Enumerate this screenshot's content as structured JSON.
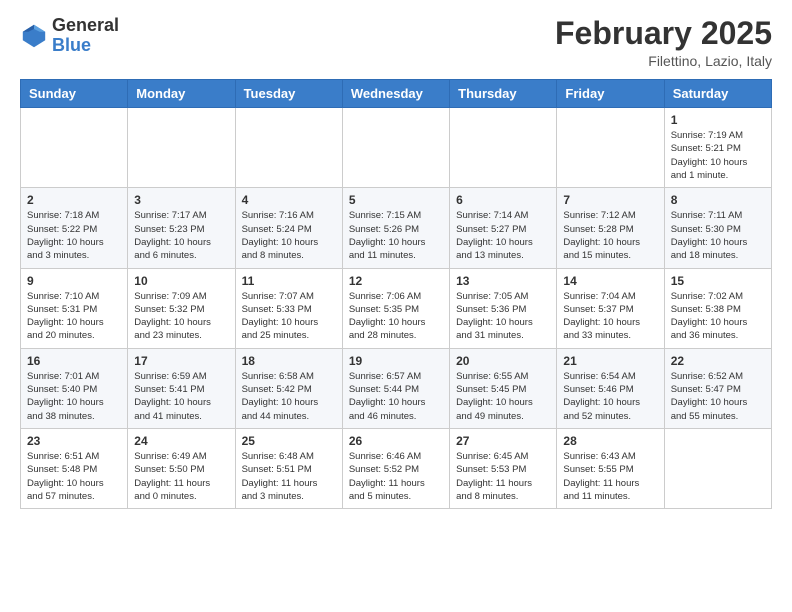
{
  "header": {
    "logo_general": "General",
    "logo_blue": "Blue",
    "month_title": "February 2025",
    "subtitle": "Filettino, Lazio, Italy"
  },
  "days_of_week": [
    "Sunday",
    "Monday",
    "Tuesday",
    "Wednesday",
    "Thursday",
    "Friday",
    "Saturday"
  ],
  "weeks": [
    [
      {
        "day": "",
        "info": ""
      },
      {
        "day": "",
        "info": ""
      },
      {
        "day": "",
        "info": ""
      },
      {
        "day": "",
        "info": ""
      },
      {
        "day": "",
        "info": ""
      },
      {
        "day": "",
        "info": ""
      },
      {
        "day": "1",
        "info": "Sunrise: 7:19 AM\nSunset: 5:21 PM\nDaylight: 10 hours\nand 1 minute."
      }
    ],
    [
      {
        "day": "2",
        "info": "Sunrise: 7:18 AM\nSunset: 5:22 PM\nDaylight: 10 hours\nand 3 minutes."
      },
      {
        "day": "3",
        "info": "Sunrise: 7:17 AM\nSunset: 5:23 PM\nDaylight: 10 hours\nand 6 minutes."
      },
      {
        "day": "4",
        "info": "Sunrise: 7:16 AM\nSunset: 5:24 PM\nDaylight: 10 hours\nand 8 minutes."
      },
      {
        "day": "5",
        "info": "Sunrise: 7:15 AM\nSunset: 5:26 PM\nDaylight: 10 hours\nand 11 minutes."
      },
      {
        "day": "6",
        "info": "Sunrise: 7:14 AM\nSunset: 5:27 PM\nDaylight: 10 hours\nand 13 minutes."
      },
      {
        "day": "7",
        "info": "Sunrise: 7:12 AM\nSunset: 5:28 PM\nDaylight: 10 hours\nand 15 minutes."
      },
      {
        "day": "8",
        "info": "Sunrise: 7:11 AM\nSunset: 5:30 PM\nDaylight: 10 hours\nand 18 minutes."
      }
    ],
    [
      {
        "day": "9",
        "info": "Sunrise: 7:10 AM\nSunset: 5:31 PM\nDaylight: 10 hours\nand 20 minutes."
      },
      {
        "day": "10",
        "info": "Sunrise: 7:09 AM\nSunset: 5:32 PM\nDaylight: 10 hours\nand 23 minutes."
      },
      {
        "day": "11",
        "info": "Sunrise: 7:07 AM\nSunset: 5:33 PM\nDaylight: 10 hours\nand 25 minutes."
      },
      {
        "day": "12",
        "info": "Sunrise: 7:06 AM\nSunset: 5:35 PM\nDaylight: 10 hours\nand 28 minutes."
      },
      {
        "day": "13",
        "info": "Sunrise: 7:05 AM\nSunset: 5:36 PM\nDaylight: 10 hours\nand 31 minutes."
      },
      {
        "day": "14",
        "info": "Sunrise: 7:04 AM\nSunset: 5:37 PM\nDaylight: 10 hours\nand 33 minutes."
      },
      {
        "day": "15",
        "info": "Sunrise: 7:02 AM\nSunset: 5:38 PM\nDaylight: 10 hours\nand 36 minutes."
      }
    ],
    [
      {
        "day": "16",
        "info": "Sunrise: 7:01 AM\nSunset: 5:40 PM\nDaylight: 10 hours\nand 38 minutes."
      },
      {
        "day": "17",
        "info": "Sunrise: 6:59 AM\nSunset: 5:41 PM\nDaylight: 10 hours\nand 41 minutes."
      },
      {
        "day": "18",
        "info": "Sunrise: 6:58 AM\nSunset: 5:42 PM\nDaylight: 10 hours\nand 44 minutes."
      },
      {
        "day": "19",
        "info": "Sunrise: 6:57 AM\nSunset: 5:44 PM\nDaylight: 10 hours\nand 46 minutes."
      },
      {
        "day": "20",
        "info": "Sunrise: 6:55 AM\nSunset: 5:45 PM\nDaylight: 10 hours\nand 49 minutes."
      },
      {
        "day": "21",
        "info": "Sunrise: 6:54 AM\nSunset: 5:46 PM\nDaylight: 10 hours\nand 52 minutes."
      },
      {
        "day": "22",
        "info": "Sunrise: 6:52 AM\nSunset: 5:47 PM\nDaylight: 10 hours\nand 55 minutes."
      }
    ],
    [
      {
        "day": "23",
        "info": "Sunrise: 6:51 AM\nSunset: 5:48 PM\nDaylight: 10 hours\nand 57 minutes."
      },
      {
        "day": "24",
        "info": "Sunrise: 6:49 AM\nSunset: 5:50 PM\nDaylight: 11 hours\nand 0 minutes."
      },
      {
        "day": "25",
        "info": "Sunrise: 6:48 AM\nSunset: 5:51 PM\nDaylight: 11 hours\nand 3 minutes."
      },
      {
        "day": "26",
        "info": "Sunrise: 6:46 AM\nSunset: 5:52 PM\nDaylight: 11 hours\nand 5 minutes."
      },
      {
        "day": "27",
        "info": "Sunrise: 6:45 AM\nSunset: 5:53 PM\nDaylight: 11 hours\nand 8 minutes."
      },
      {
        "day": "28",
        "info": "Sunrise: 6:43 AM\nSunset: 5:55 PM\nDaylight: 11 hours\nand 11 minutes."
      },
      {
        "day": "",
        "info": ""
      }
    ]
  ]
}
